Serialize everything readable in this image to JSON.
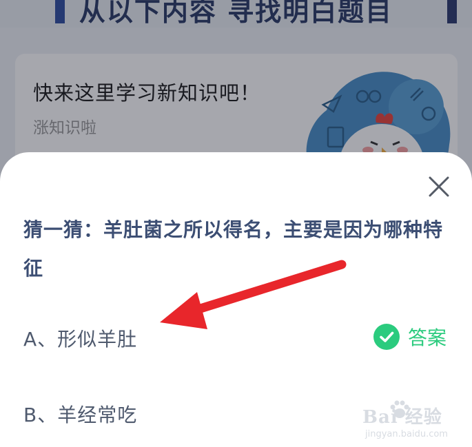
{
  "background_page": {
    "banner_title": "从以下内容 寻找明白题目",
    "card": {
      "title": "快来这里学习新知识吧！",
      "subtitle": "涨知识啦"
    }
  },
  "popup": {
    "question": "猜一猜：羊肚菌之所以得名，主要是因为哪种特征",
    "options": [
      {
        "label": "A、形似羊肚",
        "is_answer": true,
        "answer_label": "答案"
      },
      {
        "label": "B、羊经常吃",
        "is_answer": false
      }
    ]
  },
  "icons": {
    "close": "close-icon",
    "check": "check-circle-icon",
    "annotation": "red-arrow-annotation"
  },
  "watermark": {
    "text": "Bai 经验",
    "sub": "jingyan.baidu.com"
  },
  "colors": {
    "question_text": "#3c4e73",
    "option_text": "#4f5a6e",
    "answer_green": "#2bcb7e",
    "arrow_red": "#e8262b"
  }
}
